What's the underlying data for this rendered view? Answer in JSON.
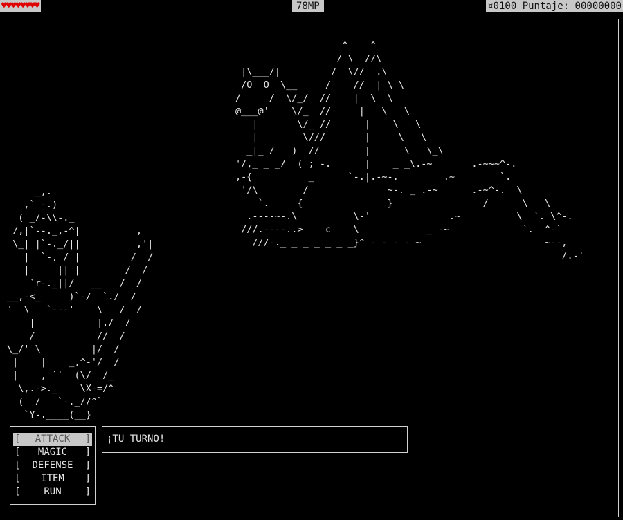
{
  "hud": {
    "hearts": "♥♥♥♥♥♥♥♥",
    "mp": "78MP",
    "score": "¤0100 Puntaje: 00000000"
  },
  "colors": {
    "background": "#000000",
    "text": "#e6e6e6",
    "hud_bar": "#c8c8c8",
    "heart": "#e00000"
  },
  "enemy_art": "                   ^    ^\n                  / \\  //\\\n |\\___/|         /  \\//  .\\\n /O  O  \\__     /    //  | \\ \\\n/     /  \\/_/  //    |  \\  \\\n@___@'    \\/_  //     |   \\   \\\n   |       \\/_ //      |    \\   \\\n   |        \\///       |     \\   \\\n  _|_ /   )  //        |      \\   \\_\\\n'/,_ _ _/  ( ; -.      |    _ _\\.-~       .-~~~^-.\n,-{          _      `-.|.-~-.        .~        `.\n '/\\        /              ~-. _ .-~      .-~^-.  \\\n    `.     {               }                /      \\   \\\n  .----~-.\\          \\-'              .~          \\  `. \\^-.\n ///.----..>    c    \\            _ -~             `.  ^-`\n   ///-._ _ _ _ _ _ _}^ - - - - ~                      ~--,\n                                                          /.-'",
  "hero_art": "     _,.\n   ,` -.)\n  ( _/-\\\\-._\n /,|`--._,-^|          ,\n \\_| |`-._/||          ,'|\n   |  `-, / |         /  /\n   |     || |        /  /\n    `r-._||/   __   /  /\n__,-<_     )`-/  `./  /\n'  \\   `---'    \\   /  /\n    |           |./  /\n    /           //  /\n\\_/' \\         |/  /\n |    |    _,^-'/  /\n |    , ``  (\\/  /_\n  \\,.->._    \\X-=/^\n  (  /   `-._//^`\n   `Y-.____(__}",
  "menu": {
    "items": [
      "ATTACK",
      "MAGIC",
      "DEFENSE",
      "ITEM",
      "RUN"
    ],
    "selected": "ATTACK",
    "bracket_left": "[",
    "bracket_right": "]"
  },
  "message": "¡TU TURNO!"
}
